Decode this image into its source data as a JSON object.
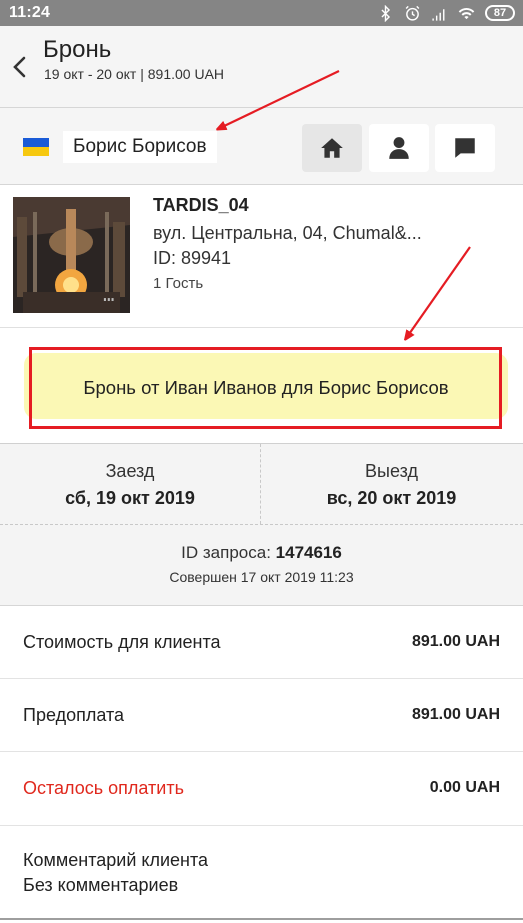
{
  "status_bar": {
    "time": "11:24",
    "battery": "87",
    "icons": [
      "bluetooth-icon",
      "alarm-icon",
      "signal-icon",
      "wifi-icon",
      "battery-icon"
    ]
  },
  "header": {
    "title": "Бронь",
    "subtitle": "19 окт - 20 окт | 891.00 UAH"
  },
  "guest": {
    "name": "Борис Борисов",
    "tabs": [
      {
        "icon": "home-icon",
        "active": true
      },
      {
        "icon": "person-icon",
        "active": false
      },
      {
        "icon": "chat-icon",
        "active": false
      }
    ]
  },
  "property": {
    "name": "TARDIS_04",
    "address": "вул. Центральна, 04, Chumal&...",
    "id": "ID: 89941",
    "guests": "1 Гость"
  },
  "note": {
    "text": "Бронь от Иван Иванов для Борис Борисов"
  },
  "dates": {
    "checkin_label": "Заезд",
    "checkin_value": "сб, 19 окт 2019",
    "checkout_label": "Выезд",
    "checkout_value": "вс, 20 окт 2019"
  },
  "request": {
    "id_label": "ID запроса:",
    "id_value": "1474616",
    "created": "Совершен 17 окт 2019 11:23"
  },
  "costs": [
    {
      "label": "Стоимость для клиента",
      "value": "891.00 UAH",
      "highlight": false
    },
    {
      "label": "Предоплата",
      "value": "891.00 UAH",
      "highlight": false
    },
    {
      "label": "Осталось оплатить",
      "value": "0.00 UAH",
      "highlight": true
    }
  ],
  "comment": {
    "label": "Комментарий клиента",
    "value": "Без комментариев"
  },
  "colors": {
    "accent_red": "#e51c23",
    "note_bg": "#fbf8b5",
    "header_bg": "#f5f5f5"
  }
}
